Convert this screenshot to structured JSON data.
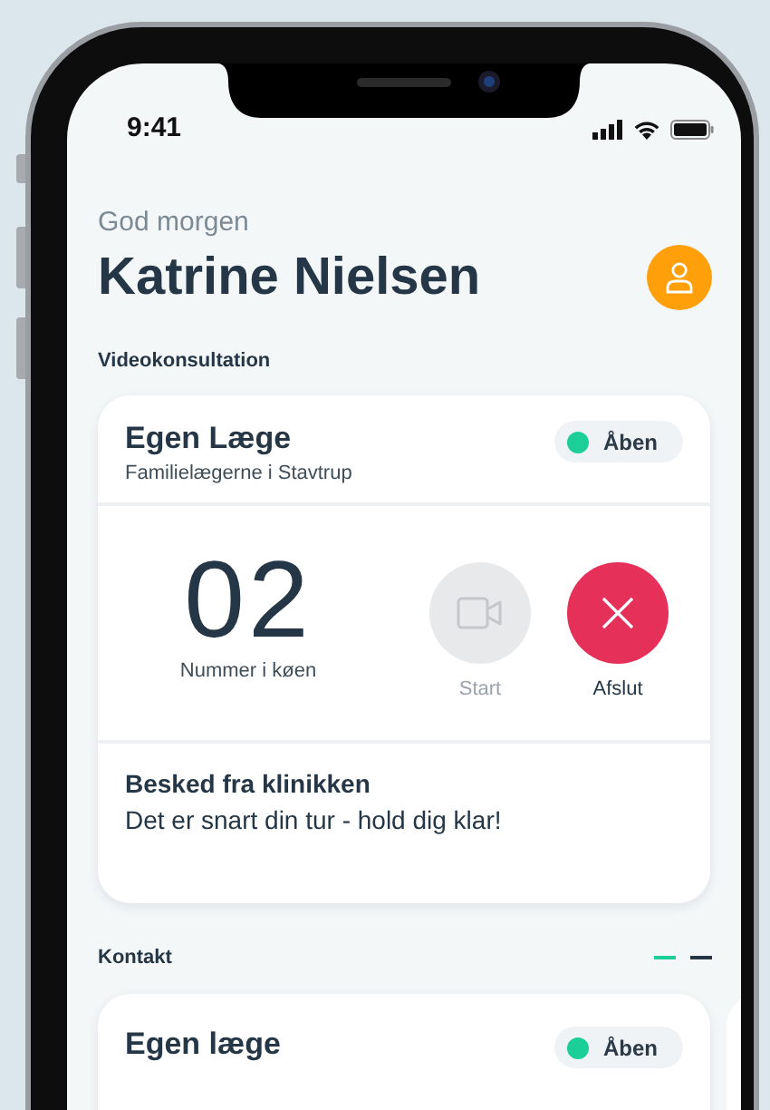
{
  "status_bar": {
    "time": "9:41"
  },
  "greeting": "God morgen",
  "user_name": "Katrine Nielsen",
  "video_section": {
    "title": "Videokonsultation",
    "card": {
      "title": "Egen Læge",
      "subtitle": "Familielægerne i Stavtrup",
      "status": {
        "label": "Åben",
        "open": true
      },
      "queue_number": "02",
      "queue_label": "Nummer i køen",
      "actions": [
        {
          "kind": "start",
          "label": "Start",
          "disabled": true
        },
        {
          "kind": "end",
          "label": "Afslut",
          "disabled": false
        }
      ],
      "message": {
        "title": "Besked fra klinikken",
        "text": "Det er snart din tur - hold dig klar!"
      }
    }
  },
  "contact_section": {
    "title": "Kontakt",
    "pager": [
      {
        "selected": true
      },
      {
        "selected": false
      }
    ],
    "card": {
      "title": "Egen læge",
      "status": {
        "label": "Åben",
        "open": true
      }
    }
  }
}
